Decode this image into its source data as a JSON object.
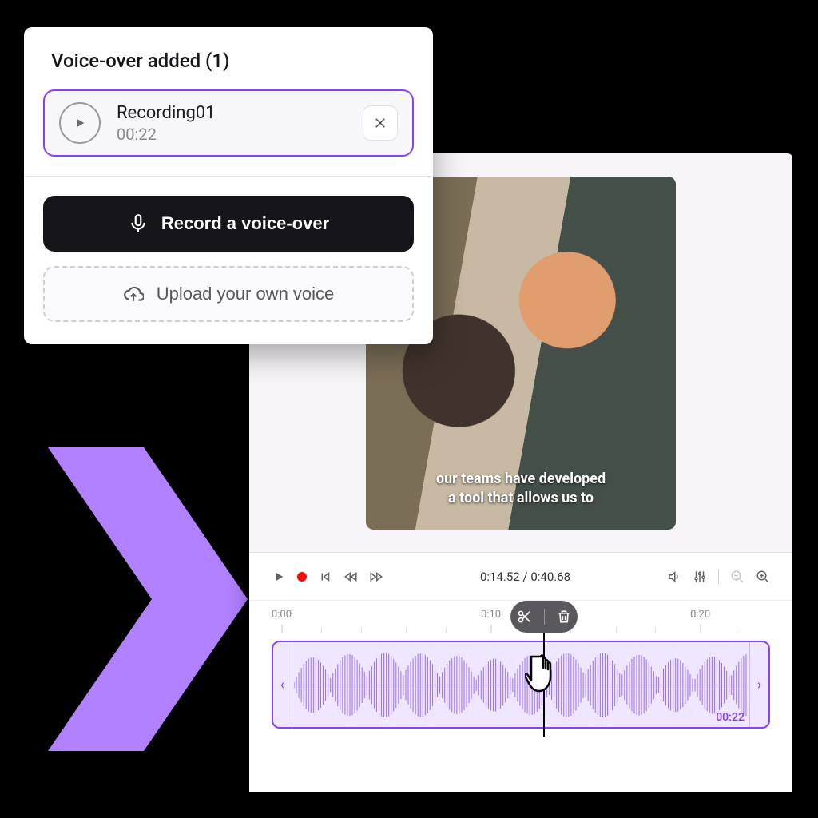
{
  "voiceover_panel": {
    "title": "Voice-over added (1)",
    "item": {
      "name": "Recording01",
      "duration": "00:22"
    },
    "record_label": "Record a voice-over",
    "upload_label": "Upload your own voice"
  },
  "preview": {
    "caption_line1": "our teams have developed",
    "caption_line2": "a tool that allows us to"
  },
  "timeline": {
    "time_current": "0:14.52",
    "time_total": "0:40.68",
    "ticks": [
      "0:00",
      "0:10",
      "0:20"
    ],
    "clip_duration": "00:22"
  },
  "colors": {
    "accent": "#8a3ffc"
  }
}
